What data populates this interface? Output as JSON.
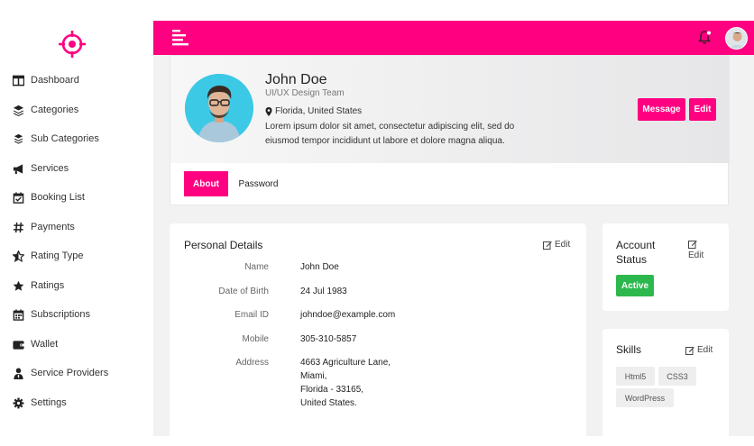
{
  "sidebar": {
    "items": [
      {
        "label": "Dashboard",
        "icon": "dashboard-icon"
      },
      {
        "label": "Categories",
        "icon": "layers-icon"
      },
      {
        "label": "Sub Categories",
        "icon": "layers-icon"
      },
      {
        "label": "Services",
        "icon": "megaphone-icon"
      },
      {
        "label": "Booking List",
        "icon": "calendar-check-icon"
      },
      {
        "label": "Payments",
        "icon": "hash-icon"
      },
      {
        "label": "Rating Type",
        "icon": "star-half-icon"
      },
      {
        "label": "Ratings",
        "icon": "star-icon"
      },
      {
        "label": "Subscriptions",
        "icon": "calendar-icon"
      },
      {
        "label": "Wallet",
        "icon": "wallet-icon"
      },
      {
        "label": "Service Providers",
        "icon": "user-tie-icon"
      },
      {
        "label": "Settings",
        "icon": "gear-icon"
      }
    ]
  },
  "colors": {
    "accent": "#fe0080",
    "active_badge": "#2db84d"
  },
  "profile": {
    "name": "John Doe",
    "team": "UI/UX Design Team",
    "location": "Florida, United States",
    "about": "Lorem ipsum dolor sit amet, consectetur adipiscing elit, sed do eiusmod tempor incididunt ut labore et dolore magna aliqua.",
    "message_label": "Message",
    "edit_label": "Edit"
  },
  "tabs": [
    {
      "label": "About",
      "active": true
    },
    {
      "label": "Password",
      "active": false
    }
  ],
  "personal": {
    "title": "Personal Details",
    "edit_label": "Edit",
    "rows": [
      {
        "label": "Name",
        "value": "John Doe"
      },
      {
        "label": "Date of Birth",
        "value": "24 Jul 1983"
      },
      {
        "label": "Email ID",
        "value": "johndoe@example.com"
      },
      {
        "label": "Mobile",
        "value": "305-310-5857"
      },
      {
        "label": "Address",
        "value": "4663 Agriculture Lane,\nMiami,\nFlorida - 33165,\nUnited States."
      }
    ]
  },
  "account": {
    "title_line1": "Account",
    "title_line2": "Status",
    "edit_label": "Edit",
    "status": "Active"
  },
  "skills": {
    "title": "Skills",
    "edit_label": "Edit",
    "items": [
      "Html5",
      "CSS3",
      "WordPress"
    ]
  }
}
